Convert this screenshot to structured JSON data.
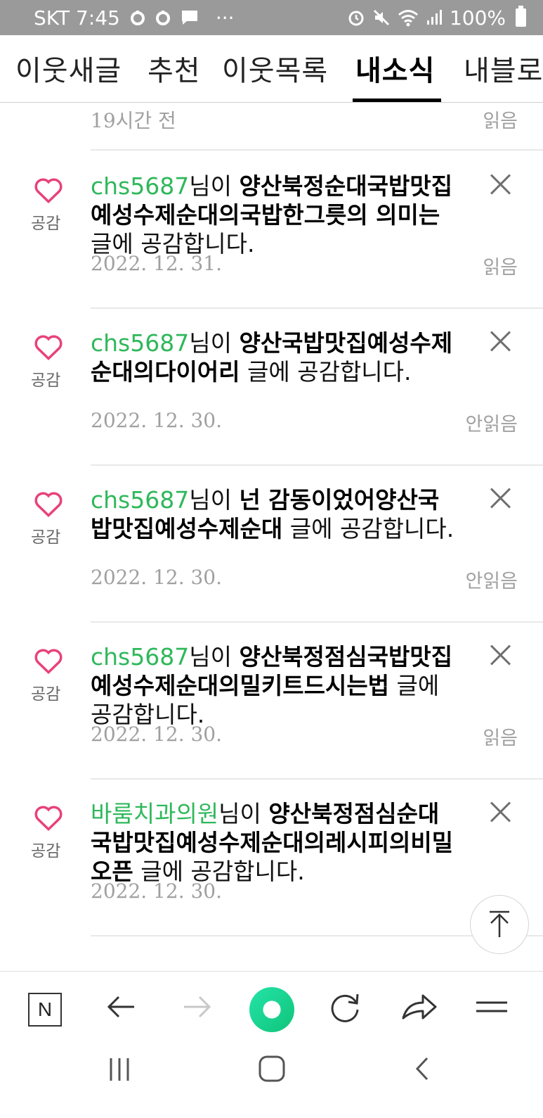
{
  "status_bar": {
    "carrier_time": "SKT 7:45",
    "dots": "···",
    "battery": "100%",
    "left_icons": [
      "notification-dot-icon",
      "notification-dot-icon",
      "message-icon"
    ],
    "right_icons": [
      "alarm-icon",
      "mute-icon",
      "wifi-icon",
      "signal-icon",
      "battery-icon"
    ]
  },
  "tabs": [
    {
      "label": "이웃새글",
      "active": false
    },
    {
      "label": "추천",
      "active": false
    },
    {
      "label": "이웃목록",
      "active": false
    },
    {
      "label": "내소식",
      "active": true
    },
    {
      "label": "내블로그",
      "active": false
    }
  ],
  "partial_row": {
    "date": "19시간 전",
    "read": "읽음"
  },
  "notifications": [
    {
      "icon_label": "공감",
      "user": "chs5687",
      "user_suffix": "님이 ",
      "title": "양산북정순대국밥맛집예성수제순대의국밥한그릇의 의미는",
      "suffix": " 글에 공감합니다.",
      "date": "2022. 12. 31.",
      "read": "읽음"
    },
    {
      "icon_label": "공감",
      "user": "chs5687",
      "user_suffix": "님이 ",
      "title": "양산국밥맛집예성수제순대의다이어리",
      "suffix": " 글에 공감합니다.",
      "date": "2022. 12. 30.",
      "read": "안읽음"
    },
    {
      "icon_label": "공감",
      "user": "chs5687",
      "user_suffix": "님이 ",
      "title": "넌 감동이었어양산국밥맛집예성수제순대",
      "suffix": " 글에 공감합니다.",
      "date": "2022. 12. 30.",
      "read": "안읽음"
    },
    {
      "icon_label": "공감",
      "user": "chs5687",
      "user_suffix": "님이 ",
      "title": "양산북정점심국밥맛집예성수제순대의밀키트드시는법",
      "suffix": " 글에 공감합니다.",
      "date": "2022. 12. 30.",
      "read": "읽음"
    },
    {
      "icon_label": "공감",
      "user": "바룸치과의원",
      "user_suffix": "님이 ",
      "title": "양산북정점심순대국밥맛집예성수제순대의레시피의비밀오픈",
      "suffix": " 글에 공감합니다.",
      "date": "2022. 12. 30.",
      "read": ""
    }
  ],
  "browser_bar": {
    "n_label": "N",
    "icons": [
      "naver-home-icon",
      "back-arrow-icon",
      "forward-arrow-icon",
      "green-dot-icon",
      "refresh-icon",
      "share-icon",
      "menu-icon"
    ]
  },
  "colors": {
    "user_green": "#2fb85b",
    "heart_pink": "#e8427a",
    "status_bar": "#9a9a9a"
  }
}
